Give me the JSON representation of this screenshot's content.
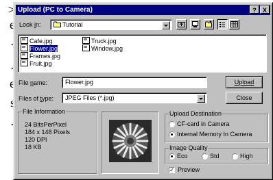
{
  "background_text": [
    ">",
    "e",
    "-",
    "-",
    "e",
    "s",
    "-"
  ],
  "window": {
    "title": "Upload (PC to Camera)",
    "help_button": "?",
    "close_button": "X"
  },
  "lookin": {
    "label_pre": "Look ",
    "label_key": "i",
    "label_post": "n:",
    "value": "Tutorial"
  },
  "files": [
    {
      "name": "Cafe.jpg",
      "selected": false
    },
    {
      "name": "Flower.jpg",
      "selected": true
    },
    {
      "name": "Frames.jpg",
      "selected": false
    },
    {
      "name": "Fruit.jpg",
      "selected": false
    },
    {
      "name": "Truck.jpg",
      "selected": false
    },
    {
      "name": "Window.jpg",
      "selected": false
    }
  ],
  "filename": {
    "label_pre": "File ",
    "label_key": "n",
    "label_post": "ame:",
    "value": "Flower.jpg"
  },
  "filetype": {
    "label_pre": "Files of ",
    "label_key": "t",
    "label_post": "ype:",
    "value": "JPEG Files (*.jpg)"
  },
  "buttons": {
    "upload": "Upload",
    "close": "Close"
  },
  "file_info": {
    "title": "File Information",
    "lines": [
      "24 BitsPerPixel",
      "184 x 148 Pixels",
      "120 DPI",
      "18 KB"
    ]
  },
  "upload_destination": {
    "title": "Upload Destination",
    "options": [
      "CF-card in Camera",
      "Internal Memory In Camera"
    ],
    "selected_index": 1
  },
  "image_quality": {
    "title": "Image Quality",
    "options": [
      "Eco",
      "Std",
      "High"
    ],
    "selected_index": 0
  },
  "preview": {
    "label": "Preview",
    "checked": true
  }
}
